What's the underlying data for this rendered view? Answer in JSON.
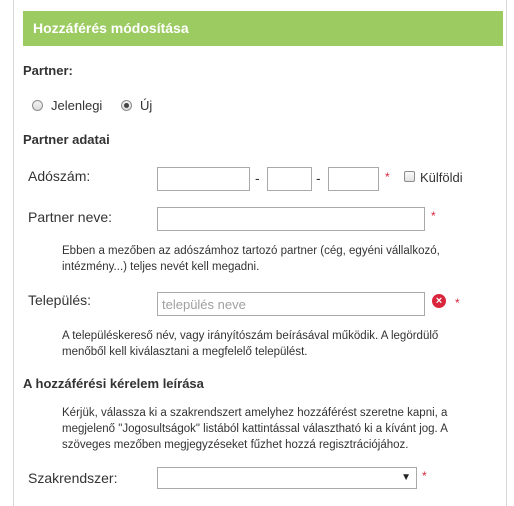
{
  "header": {
    "title": "Hozzáférés módosítása"
  },
  "partner_section": {
    "label": "Partner:",
    "options": [
      {
        "label": "Jelenlegi",
        "checked": false
      },
      {
        "label": "Új",
        "checked": true
      }
    ]
  },
  "partner_data": {
    "heading": "Partner adatai",
    "tax_number": {
      "label": "Adószám:",
      "separator": "-",
      "part1": "",
      "part2": "",
      "part3": ""
    },
    "foreign": {
      "label": "Külföldi",
      "checked": false
    },
    "partner_name": {
      "label": "Partner neve:",
      "value": "",
      "note": "Ebben a mezőben az adószámhoz tartozó partner (cég, egyéni vállalkozó, intézmény...) teljes nevét kell megadni."
    },
    "settlement": {
      "label": "Település:",
      "placeholder": "település neve",
      "note": "A településkereső név, vagy irányítószám beírásával működik. A legördülő menőből kell kiválasztani a megfelelő települést."
    },
    "required_mark": "*"
  },
  "access_request": {
    "heading": "A hozzáférési kérelem leírása",
    "note": "Kérjük, válassza ki a szakrendszert amelyhez hozzáférést szeretne kapni, a megjelenő \"Jogosultságok\" listából kattintással választható ki a kívánt jog. A szöveges mezőben megjegyzéseket fűzhet hozzá regisztrációjához.",
    "system": {
      "label": "Szakrendszer:",
      "selected": ""
    }
  },
  "icons": {
    "clear": "clear-x-icon",
    "dropdown": "chevron-down-icon"
  },
  "colors": {
    "header_bg": "#9ccb62",
    "required": "#d9263c"
  }
}
